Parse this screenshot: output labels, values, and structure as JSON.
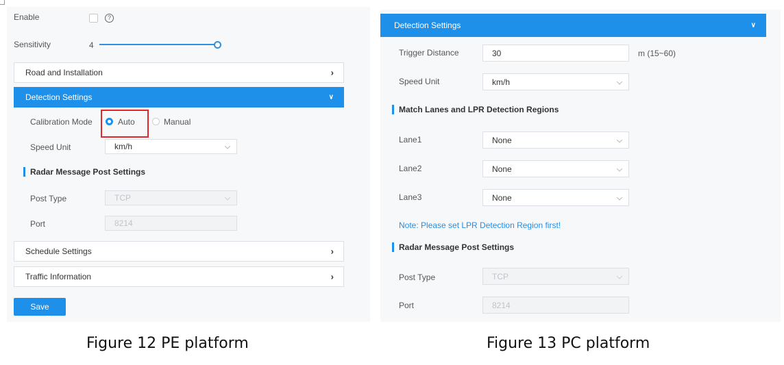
{
  "pe": {
    "enable_label": "Enable",
    "help_icon": "?",
    "sensitivity_label": "Sensitivity",
    "sensitivity_value": "4",
    "sensitivity_level_fraction": 1.0,
    "road_installation": "Road and Installation",
    "detection_settings": "Detection Settings",
    "calibration_mode_label": "Calibration Mode",
    "calibration_auto": "Auto",
    "calibration_manual": "Manual",
    "speed_unit_label": "Speed Unit",
    "speed_unit_value": "km/h",
    "radar_section": "Radar Message Post Settings",
    "post_type_label": "Post Type",
    "post_type_value": "TCP",
    "port_label": "Port",
    "port_value": "8214",
    "schedule_settings": "Schedule Settings",
    "traffic_information": "Traffic Information",
    "save_label": "Save"
  },
  "pc": {
    "detection_settings": "Detection Settings",
    "trigger_distance_label": "Trigger Distance",
    "trigger_distance_value": "30",
    "trigger_distance_range": "m (15~60)",
    "speed_unit_label": "Speed Unit",
    "speed_unit_value": "km/h",
    "match_section": "Match Lanes and LPR Detection Regions",
    "lanes": [
      {
        "label": "Lane1",
        "value": "None"
      },
      {
        "label": "Lane2",
        "value": "None"
      },
      {
        "label": "Lane3",
        "value": "None"
      }
    ],
    "note": "Note: Please set LPR Detection Region first!",
    "radar_section": "Radar Message Post Settings",
    "post_type_label": "Post Type",
    "post_type_value": "TCP",
    "port_label": "Port",
    "port_value": "8214"
  },
  "captions": {
    "fig12": "Figure 12 PE platform",
    "fig13": "Figure 13 PC platform"
  },
  "colors": {
    "accent": "#1e90ea",
    "highlight": "#e4262a"
  }
}
